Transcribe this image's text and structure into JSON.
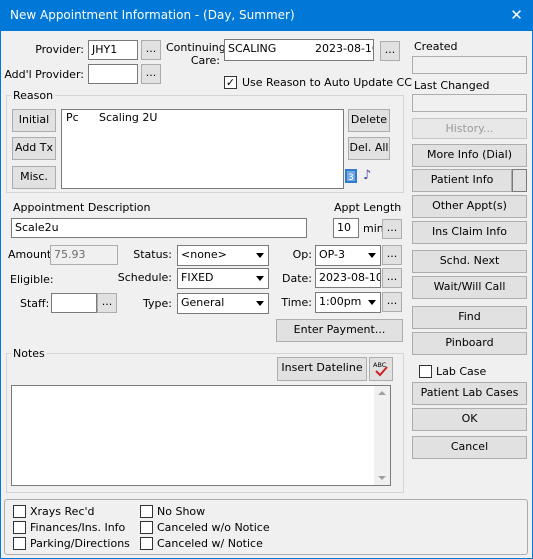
{
  "window": {
    "title": "New Appointment Information - (Day, Summer)"
  },
  "provider": {
    "label": "Provider:",
    "value": "JHY1",
    "btn": "..."
  },
  "addl_provider": {
    "label": "Add'l Provider:",
    "value": "",
    "btn": "..."
  },
  "continuing_care": {
    "label1": "Continuing",
    "label2": "Care:",
    "value": "SCALING",
    "date": "2023-08-10",
    "btn": "..."
  },
  "use_reason": {
    "label": "Use Reason to Auto Update CC",
    "checked": true
  },
  "reason": {
    "label": "Reason",
    "buttons": {
      "initial": "Initial",
      "add_tx": "Add Tx",
      "misc": "Misc.",
      "delete": "Delete",
      "del_all": "Del. All"
    },
    "items": [
      {
        "code": "Pc",
        "desc": "Scaling 2U"
      }
    ]
  },
  "appt_desc": {
    "label": "Appointment Description",
    "value": "Scale2u"
  },
  "appt_length": {
    "label": "Appt Length",
    "value": "10",
    "unit": "min",
    "btn": "..."
  },
  "amount": {
    "label": "Amount:",
    "value": "75.93"
  },
  "eligible": {
    "label": "Eligible:"
  },
  "staff": {
    "label": "Staff:",
    "value": "",
    "btn": "..."
  },
  "status": {
    "label": "Status:",
    "value": "<none>"
  },
  "schedule": {
    "label": "Schedule:",
    "value": "FIXED"
  },
  "type": {
    "label": "Type:",
    "value": "General"
  },
  "op": {
    "label": "Op:",
    "value": "OP-3",
    "btn": "..."
  },
  "date": {
    "label": "Date:",
    "value": "2023-08-10",
    "btn": "..."
  },
  "time": {
    "label": "Time:",
    "value": "1:00pm",
    "btn": "..."
  },
  "enter_payment": "Enter Payment...",
  "notes": {
    "label": "Notes",
    "insert_dateline": "Insert Dateline",
    "spell_label": "ABC",
    "value": ""
  },
  "right": {
    "created_label": "Created",
    "created_value": "",
    "last_changed_label": "Last Changed",
    "last_changed_value": "",
    "history": "History...",
    "more_info": "More Info (Dial)",
    "patient_info": "Patient Info",
    "other_appts": "Other Appt(s)",
    "ins_claim": "Ins Claim Info",
    "schd_next": "Schd. Next",
    "wait": "Wait/Will Call",
    "find": "Find",
    "pinboard": "Pinboard",
    "lab_case": "Lab Case",
    "patient_lab_cases": "Patient Lab Cases",
    "ok": "OK",
    "cancel": "Cancel"
  },
  "bottom_checks": {
    "xrays": "Xrays Rec'd",
    "finances": "Finances/Ins. Info",
    "parking": "Parking/Directions",
    "no_show": "No Show",
    "canceled_wo": "Canceled w/o Notice",
    "canceled_w": "Canceled w/ Notice"
  },
  "colors": {
    "title_bar": "#0078d7",
    "window_bg": "#f0f0f0"
  }
}
